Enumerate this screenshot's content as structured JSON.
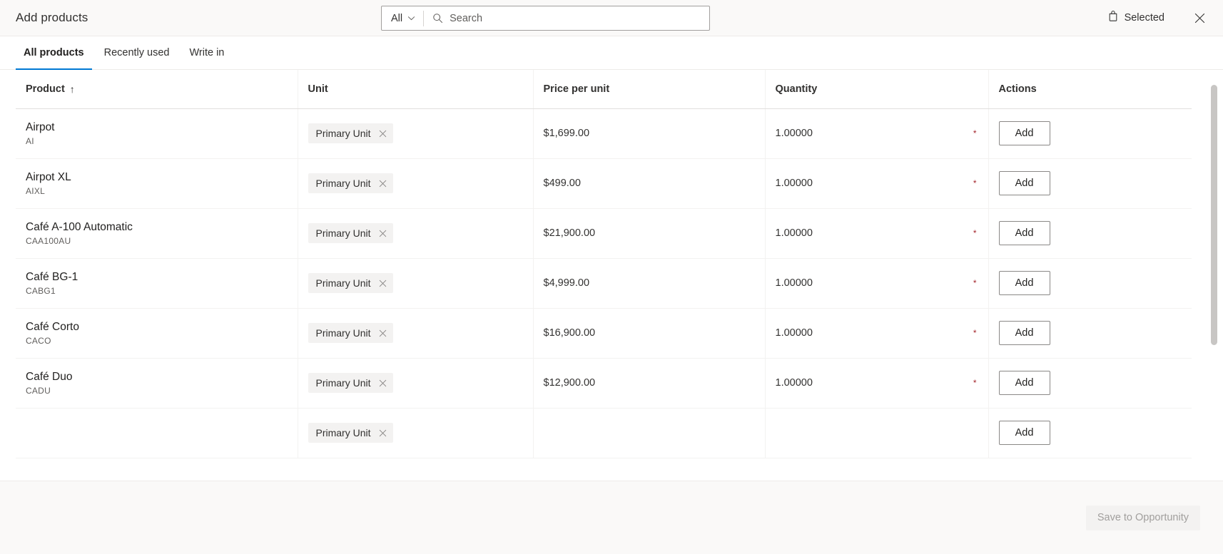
{
  "header": {
    "title": "Add products",
    "search": {
      "scope_label": "All",
      "scope_icon": "chevron-down-icon",
      "search_icon": "search-icon",
      "placeholder": "Search",
      "value": ""
    },
    "selected": {
      "label": "Selected",
      "icon": "shopping-bag-icon"
    },
    "close_icon": "close-icon"
  },
  "tabs": [
    {
      "label": "All products",
      "active": true
    },
    {
      "label": "Recently used",
      "active": false
    },
    {
      "label": "Write in",
      "active": false
    }
  ],
  "table": {
    "columns": [
      {
        "label": "Product",
        "sort": "↑"
      },
      {
        "label": "Unit",
        "sort": ""
      },
      {
        "label": "Price per unit",
        "sort": ""
      },
      {
        "label": "Quantity",
        "sort": ""
      },
      {
        "label": "Actions",
        "sort": ""
      }
    ],
    "rows": [
      {
        "name": "Airpot",
        "code": "AI",
        "unit": "Primary Unit",
        "price": "$1,699.00",
        "quantity": "1.00000",
        "required": "*",
        "action": "Add"
      },
      {
        "name": "Airpot XL",
        "code": "AIXL",
        "unit": "Primary Unit",
        "price": "$499.00",
        "quantity": "1.00000",
        "required": "*",
        "action": "Add"
      },
      {
        "name": "Café A-100 Automatic",
        "code": "CAA100AU",
        "unit": "Primary Unit",
        "price": "$21,900.00",
        "quantity": "1.00000",
        "required": "*",
        "action": "Add"
      },
      {
        "name": "Café BG-1",
        "code": "CABG1",
        "unit": "Primary Unit",
        "price": "$4,999.00",
        "quantity": "1.00000",
        "required": "*",
        "action": "Add"
      },
      {
        "name": "Café Corto",
        "code": "CACO",
        "unit": "Primary Unit",
        "price": "$16,900.00",
        "quantity": "1.00000",
        "required": "*",
        "action": "Add"
      },
      {
        "name": "Café Duo",
        "code": "CADU",
        "unit": "Primary Unit",
        "price": "$12,900.00",
        "quantity": "1.00000",
        "required": "*",
        "action": "Add"
      },
      {
        "name": "",
        "code": "",
        "unit": "Primary Unit",
        "price": "",
        "quantity": "",
        "required": "",
        "action": "Add"
      }
    ],
    "unit_remove_icon": "close-icon"
  },
  "footer": {
    "save_label": "Save to Opportunity",
    "save_disabled": true
  },
  "colors": {
    "accent": "#0078d4",
    "required_star": "#a4262c",
    "header_bg": "#faf9f8",
    "pill_bg": "#f3f2f1",
    "text_primary": "#323130",
    "text_secondary": "#605e5c"
  }
}
